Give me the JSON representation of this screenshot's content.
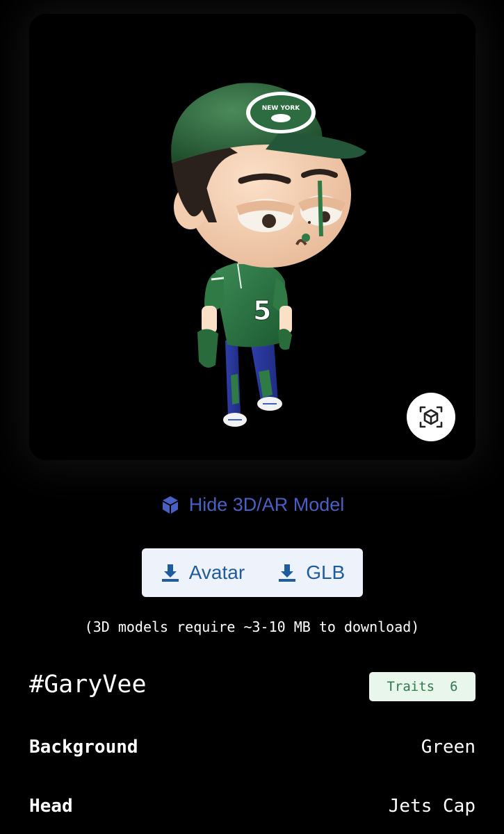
{
  "viewer": {
    "model_alt": "3D avatar wearing green New York cap and green jersey number 5",
    "cap_text": "NEW YORK",
    "jersey_number": "5",
    "ar_icon": "ar-cube-scan-icon"
  },
  "toggle": {
    "label": "Hide 3D/AR Model",
    "icon": "cube-icon",
    "color": "#4a5fc4"
  },
  "downloads": {
    "avatar_label": "Avatar",
    "glb_label": "GLB",
    "icon": "download-icon",
    "note": "(3D models require ~3-10 MB to download)"
  },
  "profile": {
    "name": "#GaryVee",
    "traits_label": "Traits",
    "traits_count": "6"
  },
  "traits": [
    {
      "label": "Background",
      "value": "Green"
    },
    {
      "label": "Head",
      "value": "Jets Cap"
    }
  ]
}
